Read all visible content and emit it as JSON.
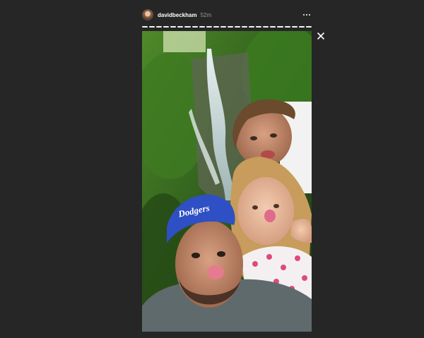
{
  "story": {
    "username": "davidbeckham",
    "timestamp": "52m",
    "progress": {
      "segments": 24,
      "current": 24
    },
    "cap_text": "Dodgers"
  },
  "colors": {
    "background": "#262626",
    "text": "#ffffff",
    "muted": "#9a9a9a",
    "cap": "#2f4fc4"
  },
  "icons": {
    "more": "more-horizontal-icon",
    "close": "close-icon",
    "avatar": "avatar"
  }
}
